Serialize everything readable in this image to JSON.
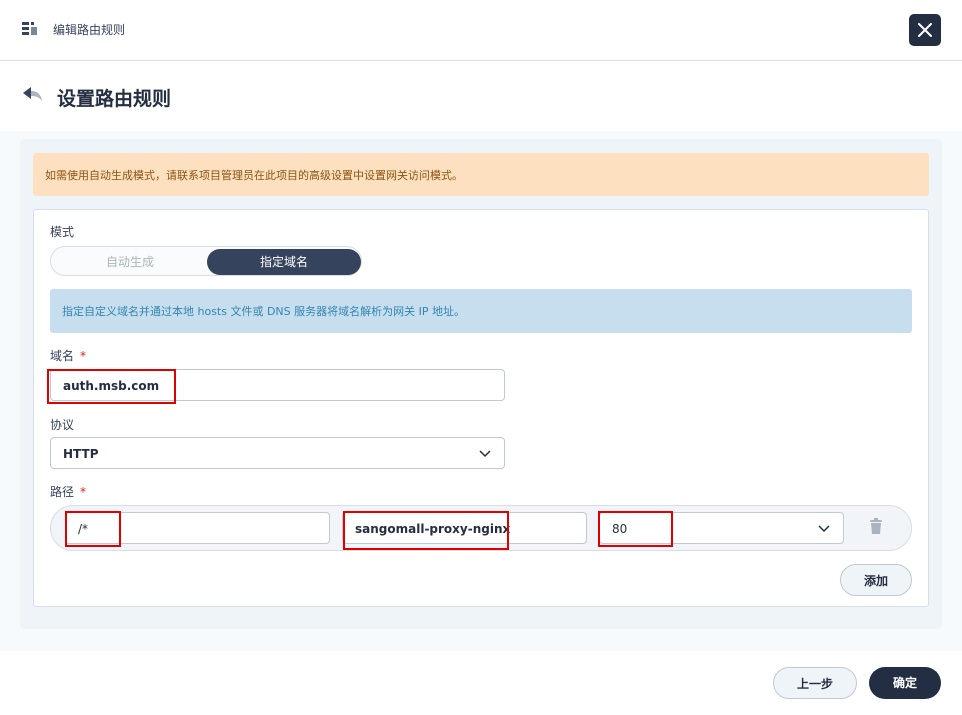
{
  "dialog": {
    "title": "编辑路由规则",
    "close_icon": "close-icon"
  },
  "page": {
    "title": "设置路由规则",
    "back_icon": "back-arrow-icon"
  },
  "warning_notice": "如需使用自动生成模式，请联系项目管理员在此项目的高级设置中设置网关访问模式。",
  "form": {
    "mode_label": "模式",
    "mode_options": [
      "自动生成",
      "指定域名"
    ],
    "mode_selected": "指定域名",
    "info_notice": "指定自定义域名并通过本地 hosts 文件或 DNS 服务器将域名解析为网关 IP 地址。",
    "domain_label": "域名",
    "domain_required": "*",
    "domain_value": "auth.msb.com",
    "protocol_label": "协议",
    "protocol_value": "HTTP",
    "path_label": "路径",
    "path_required": "*",
    "path_rows": [
      {
        "path": "/*",
        "service": "sangomall-proxy-nginx",
        "port": "80"
      }
    ],
    "add_button": "添加"
  },
  "footer": {
    "prev_button": "上一步",
    "confirm_button": "确定"
  },
  "colors": {
    "dark": "#242e42",
    "warning_bg": "#fde0bf",
    "info_bg": "#c7deef",
    "highlight": "#e00000"
  }
}
